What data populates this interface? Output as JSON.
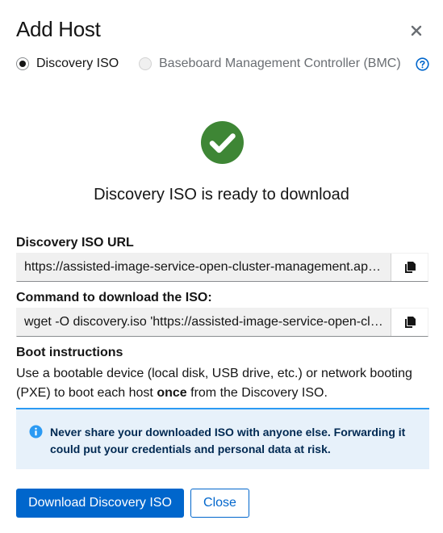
{
  "modal": {
    "title": "Add Host",
    "close_icon": "close-icon"
  },
  "host_type": {
    "options": [
      {
        "label": "Discovery ISO",
        "checked": true,
        "disabled": false
      },
      {
        "label": "Baseboard Management Controller (BMC)",
        "checked": false,
        "disabled": true
      }
    ],
    "help_icon": "question-circle-icon"
  },
  "status": {
    "icon": "check-circle-icon",
    "icon_color": "#3e8635",
    "message": "Discovery ISO is ready to download"
  },
  "iso_url": {
    "label": "Discovery ISO URL",
    "value": "https://assisted-image-service-open-cluster-management.apps.example.com/images/iso",
    "copy_icon": "copy-icon"
  },
  "download_command": {
    "label": "Command to download the ISO:",
    "value": "wget -O discovery.iso 'https://assisted-image-service-open-cluster-management.apps.example.com/images/iso'",
    "copy_icon": "copy-icon"
  },
  "boot_instructions": {
    "title": "Boot instructions",
    "text_before": "Use a bootable device (local disk, USB drive, etc.) or network booting (PXE) to boot each host ",
    "text_bold": "once",
    "text_after": " from the Discovery ISO."
  },
  "alert": {
    "icon": "info-circle-icon",
    "message": "Never share your downloaded ISO with anyone else. Forwarding it could put your credentials and personal data at risk."
  },
  "actions": {
    "download_label": "Download Discovery ISO",
    "close_label": "Close"
  },
  "colors": {
    "primary": "#0066cc",
    "success": "#3e8635",
    "info": "#2b9af3",
    "alert_bg": "#e7f1fa"
  }
}
